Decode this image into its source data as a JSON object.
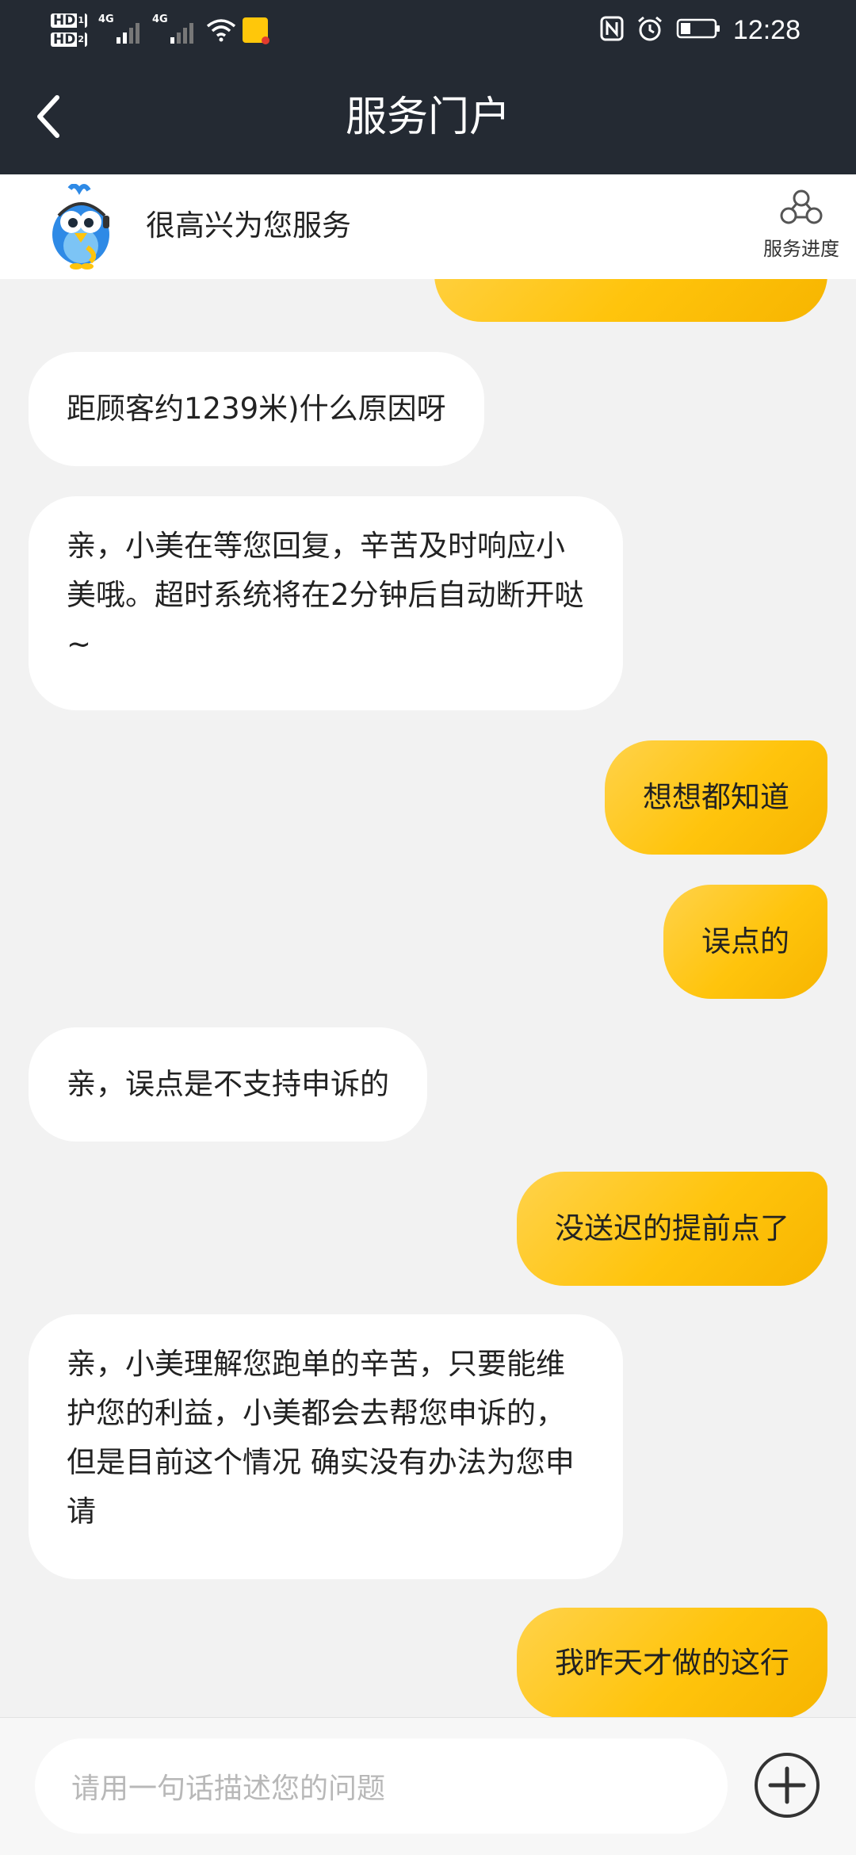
{
  "status_bar": {
    "time": "12:28",
    "network_1": "4G",
    "network_2": "4G",
    "hd_1": "HD",
    "hd_2": "HD",
    "hd_1_sim": "1",
    "hd_2_sim": "2"
  },
  "nav": {
    "title": "服务门户"
  },
  "header": {
    "welcome": "很高兴为您服务",
    "progress_label": "服务进度"
  },
  "messages": [
    {
      "side": "out",
      "text": ""
    },
    {
      "side": "in",
      "text": "距顾客约1239米)什么原因呀"
    },
    {
      "side": "in",
      "text": "亲，小美在等您回复，辛苦及时响应小美哦。超时系统将在2分钟后自动断开哒~"
    },
    {
      "side": "out",
      "text": "想想都知道"
    },
    {
      "side": "out",
      "text": "误点的"
    },
    {
      "side": "in",
      "text": "亲，误点是不支持申诉的"
    },
    {
      "side": "out",
      "text": "没送迟的提前点了"
    },
    {
      "side": "in",
      "text": "亲，小美理解您跑单的辛苦，只要能维护您的利益，小美都会去帮您申诉的，但是目前这个情况 确实没有办法为您申请"
    },
    {
      "side": "out",
      "text": "我昨天才做的这行"
    }
  ],
  "input": {
    "placeholder": "请用一句话描述您的问题"
  },
  "colors": {
    "dark_bar": "#242a33",
    "accent_yellow": "#ffc40c",
    "background": "#f2f2f2"
  }
}
